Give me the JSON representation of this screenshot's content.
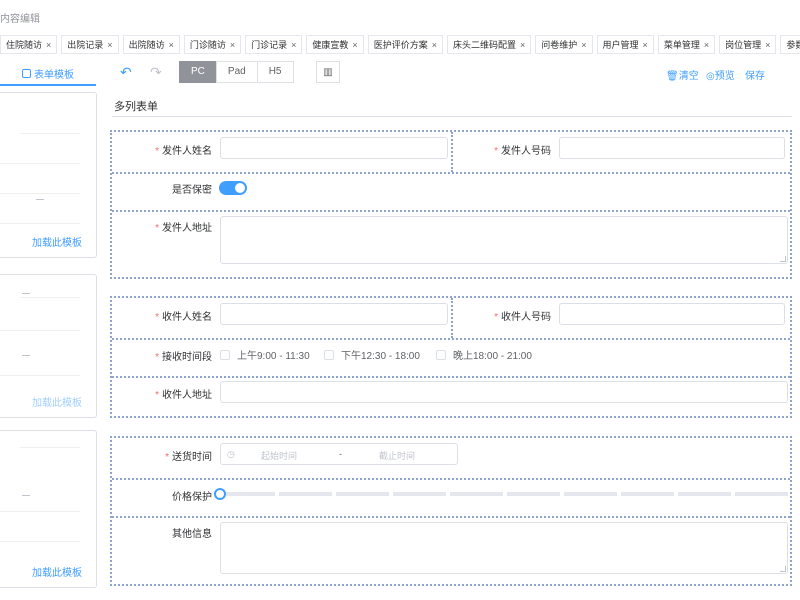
{
  "header": {
    "title": "内容编辑"
  },
  "tabs": [
    {
      "label": "住院随访"
    },
    {
      "label": "出院记录"
    },
    {
      "label": "出院随访"
    },
    {
      "label": "门诊随访"
    },
    {
      "label": "门诊记录"
    },
    {
      "label": "健康宣教"
    },
    {
      "label": "医护评价方案"
    },
    {
      "label": "床头二维码配置"
    },
    {
      "label": "问卷维护"
    },
    {
      "label": "用户管理"
    },
    {
      "label": "菜单管理"
    },
    {
      "label": "岗位管理"
    },
    {
      "label": "参数设置"
    }
  ],
  "tab_close": "×",
  "left_panel": {
    "tab_label": "表单模板",
    "load_label": "加载此模板"
  },
  "toolbar": {
    "undo": "↶",
    "redo": "↷",
    "devices": [
      "PC",
      "Pad",
      "H5"
    ],
    "active_device": "PC",
    "chart_icon": "▥",
    "clear": "清空",
    "preview": "预览",
    "save": "保存"
  },
  "form": {
    "title": "多列表单",
    "sender_name": "发件人姓名",
    "sender_phone": "发件人号码",
    "confidential": "是否保密",
    "sender_address": "发件人地址",
    "receiver_name": "收件人姓名",
    "receiver_phone": "收件人号码",
    "receive_period": "接收时间段",
    "periods": [
      "上午9:00 - 11:30",
      "下午12:30 - 18:00",
      "晚上18:00 - 21:00"
    ],
    "receiver_address": "收件人地址",
    "delivery_time": "送货时间",
    "start_time": "起始时间",
    "range_sep": "-",
    "end_time": "截止时间",
    "price_protect": "价格保护",
    "other_info": "其他信息",
    "required_mark": "*"
  },
  "colors": {
    "accent": "#409eff",
    "required": "#f56c6c",
    "dotted_border": "#8fa3c6"
  }
}
